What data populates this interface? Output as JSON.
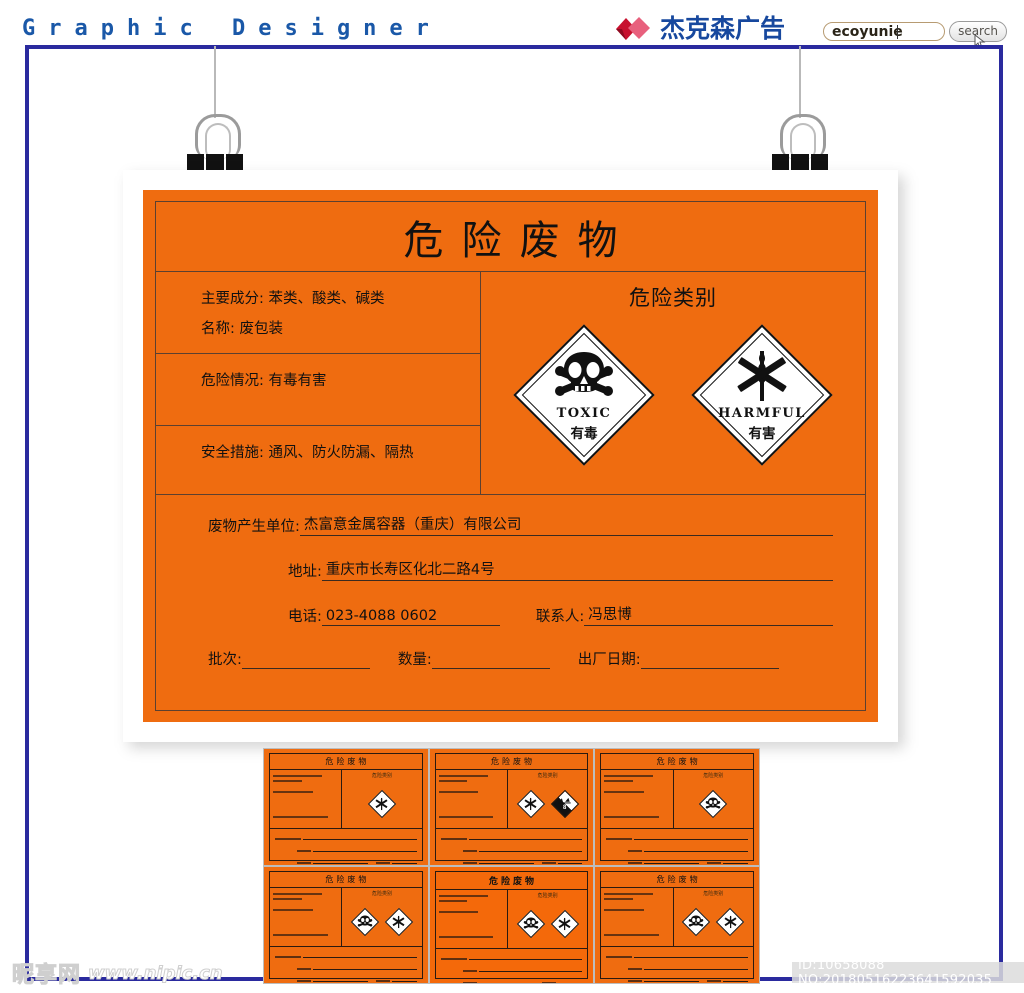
{
  "header": {
    "site_title": "Graphic Designer",
    "brand_name": "杰克森广告",
    "search_value": "ecoyunie",
    "search_button": "search"
  },
  "poster": {
    "title": "危险废物",
    "left_fields": [
      "主要成分: 苯类、酸类、碱类",
      "名称: 废包装",
      "危险情况: 有毒有害",
      "安全措施: 通风、防火防漏、隔热"
    ],
    "category_title": "危险类别",
    "hazards": [
      {
        "symbol": "skull-crossbones",
        "english": "TOXIC",
        "chinese": "有毒"
      },
      {
        "symbol": "crossed-wheat",
        "english": "HARMFUL",
        "chinese": "有害"
      }
    ],
    "info": {
      "unit_label": "废物产生单位:",
      "unit_value": "杰富意金属容器（重庆）有限公司",
      "address_label": "地址:",
      "address_value": "重庆市长寿区化北二路4号",
      "phone_label": "电话:",
      "phone_value": "023-4088 0602",
      "contact_label": "联系人:",
      "contact_value": "冯思博",
      "batch_label": "批次:",
      "batch_value": "",
      "qty_label": "数量:",
      "qty_value": "",
      "date_label": "出厂日期:",
      "date_value": ""
    }
  },
  "thumbnails": [
    {
      "title": "危险废物",
      "selected": false,
      "hazards": [
        "crossed-wheat"
      ]
    },
    {
      "title": "危险废物",
      "selected": false,
      "hazards": [
        "crossed-wheat",
        "corrosive-8"
      ]
    },
    {
      "title": "危险废物",
      "selected": false,
      "hazards": [
        "skull-crossbones"
      ]
    },
    {
      "title": "危险废物",
      "selected": false,
      "hazards": [
        "skull-crossbones",
        "crossed-wheat"
      ]
    },
    {
      "title": "危险废物",
      "selected": true,
      "hazards": [
        "skull-crossbones",
        "crossed-wheat"
      ]
    },
    {
      "title": "危险废物",
      "selected": false,
      "hazards": [
        "skull-crossbones",
        "crossed-wheat"
      ]
    }
  ],
  "footer": {
    "watermark_cn": "昵享网",
    "watermark_url": "www.nipic.cn",
    "id_text": "ID:10658088 NO:20180516223641592035"
  },
  "colors": {
    "orange": "#ef6c10",
    "brand_blue": "#17489e",
    "frame_blue": "#2a2a9e",
    "logo_red": "#d81030"
  }
}
